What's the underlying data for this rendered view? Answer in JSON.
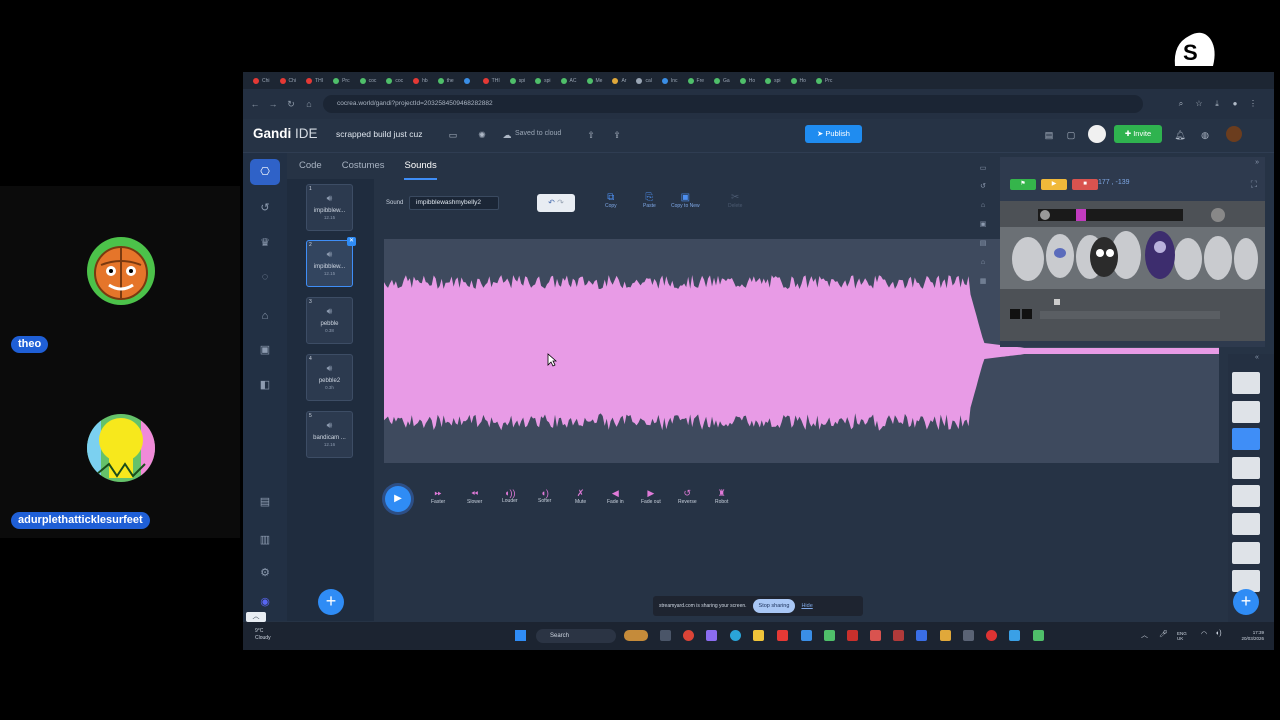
{
  "participants": [
    {
      "name": "theo"
    },
    {
      "name": "adurplethatticklesurfeet"
    }
  ],
  "overlay": {
    "brand": "streamyard"
  },
  "browser": {
    "url": "cocrea.world/gandi?projectId=203258450946​8282882",
    "tabs": [
      "Chi",
      "Chi",
      "THI",
      "Prc",
      "coc",
      "coc",
      "hb",
      "the",
      "",
      "THI",
      "spi",
      "spi",
      "AC",
      "Me",
      "Ar",
      "cal",
      "Inc",
      "Fre",
      "Ga",
      "Ho",
      "spi",
      "Ho",
      "Prc"
    ]
  },
  "gandi": {
    "logo_main": "Gandi",
    "logo_sub": "IDE",
    "project_name": "scrapped build just cuz",
    "saved_status": "Saved to cloud",
    "publish_label": "Publish",
    "invite_label": "Invite",
    "tabs": [
      "Code",
      "Costumes",
      "Sounds"
    ]
  },
  "sounds": [
    {
      "num": "1",
      "name": "impibblew...",
      "duration": "12.15"
    },
    {
      "num": "2",
      "name": "impibblew...",
      "duration": "12.15"
    },
    {
      "num": "3",
      "name": "pebble",
      "duration": "0.38"
    },
    {
      "num": "4",
      "name": "pebble2",
      "duration": "0.3h"
    },
    {
      "num": "5",
      "name": "bandicam ...",
      "duration": "12.16"
    }
  ],
  "editor": {
    "sound_label": "Sound",
    "sound_name": "impibblewashmybelly2",
    "tools": [
      "Copy",
      "Paste",
      "Copy to New",
      "Delete"
    ],
    "effects": [
      "Faster",
      "Slower",
      "Louder",
      "Softer",
      "Mute",
      "Fade in",
      "Fade out",
      "Reverse",
      "Robot"
    ]
  },
  "stage": {
    "coords": "177 , -139"
  },
  "share_notice": {
    "text": "streamyard.com is sharing your screen.",
    "stop_label": "Stop sharing",
    "hide_label": "Hide"
  },
  "taskbar": {
    "weather_temp": "9°C",
    "weather_cond": "Cloudy",
    "search_label": "Search",
    "lang_1": "ENG",
    "lang_2": "UK",
    "time": "17:39",
    "date": "20/03/2026"
  },
  "colors": {
    "waveform": "#e89be6",
    "accent": "#2f8cf5",
    "invite": "#2fb34f",
    "participant_pill": "#1f5fd6"
  }
}
